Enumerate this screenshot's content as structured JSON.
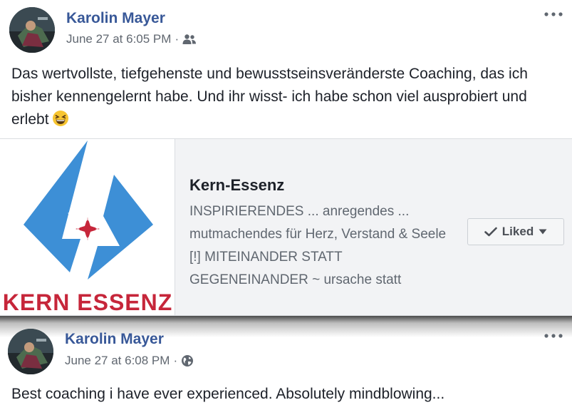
{
  "posts": [
    {
      "author": "Karolin Mayer",
      "timestamp": "June 27 at 6:05 PM",
      "separator": "·",
      "audience_icon": "friends-icon",
      "text": "Das wertvollste, tiefgehenste und bewusstseinsveränderste Coaching, das ich bisher kennengelernt habe. Und ihr wisst- ich habe schon viel ausprobiert und erlebt",
      "emoji": "grinning-squinting-face-emoji"
    },
    {
      "author": "Karolin Mayer",
      "timestamp": "June 27 at 6:08 PM",
      "separator": "·",
      "audience_icon": "globe-icon",
      "text": "Best coaching i have ever experienced. Absolutely mindblowing..."
    }
  ],
  "page_card": {
    "logo_text": "KERN ESSENZ",
    "name": "Kern-Essenz",
    "description": "INSPIRIERENDES ... anregendes ... mutmachendes für Herz, Verstand & Seele [!] MITEINANDER STATT GEGENEINANDER ~ ursache statt",
    "button_label": "Liked"
  },
  "colors": {
    "author_link": "#385898",
    "logo_blue": "#3d8fd6",
    "logo_red": "#c6263a",
    "meta_gray": "#606770"
  }
}
